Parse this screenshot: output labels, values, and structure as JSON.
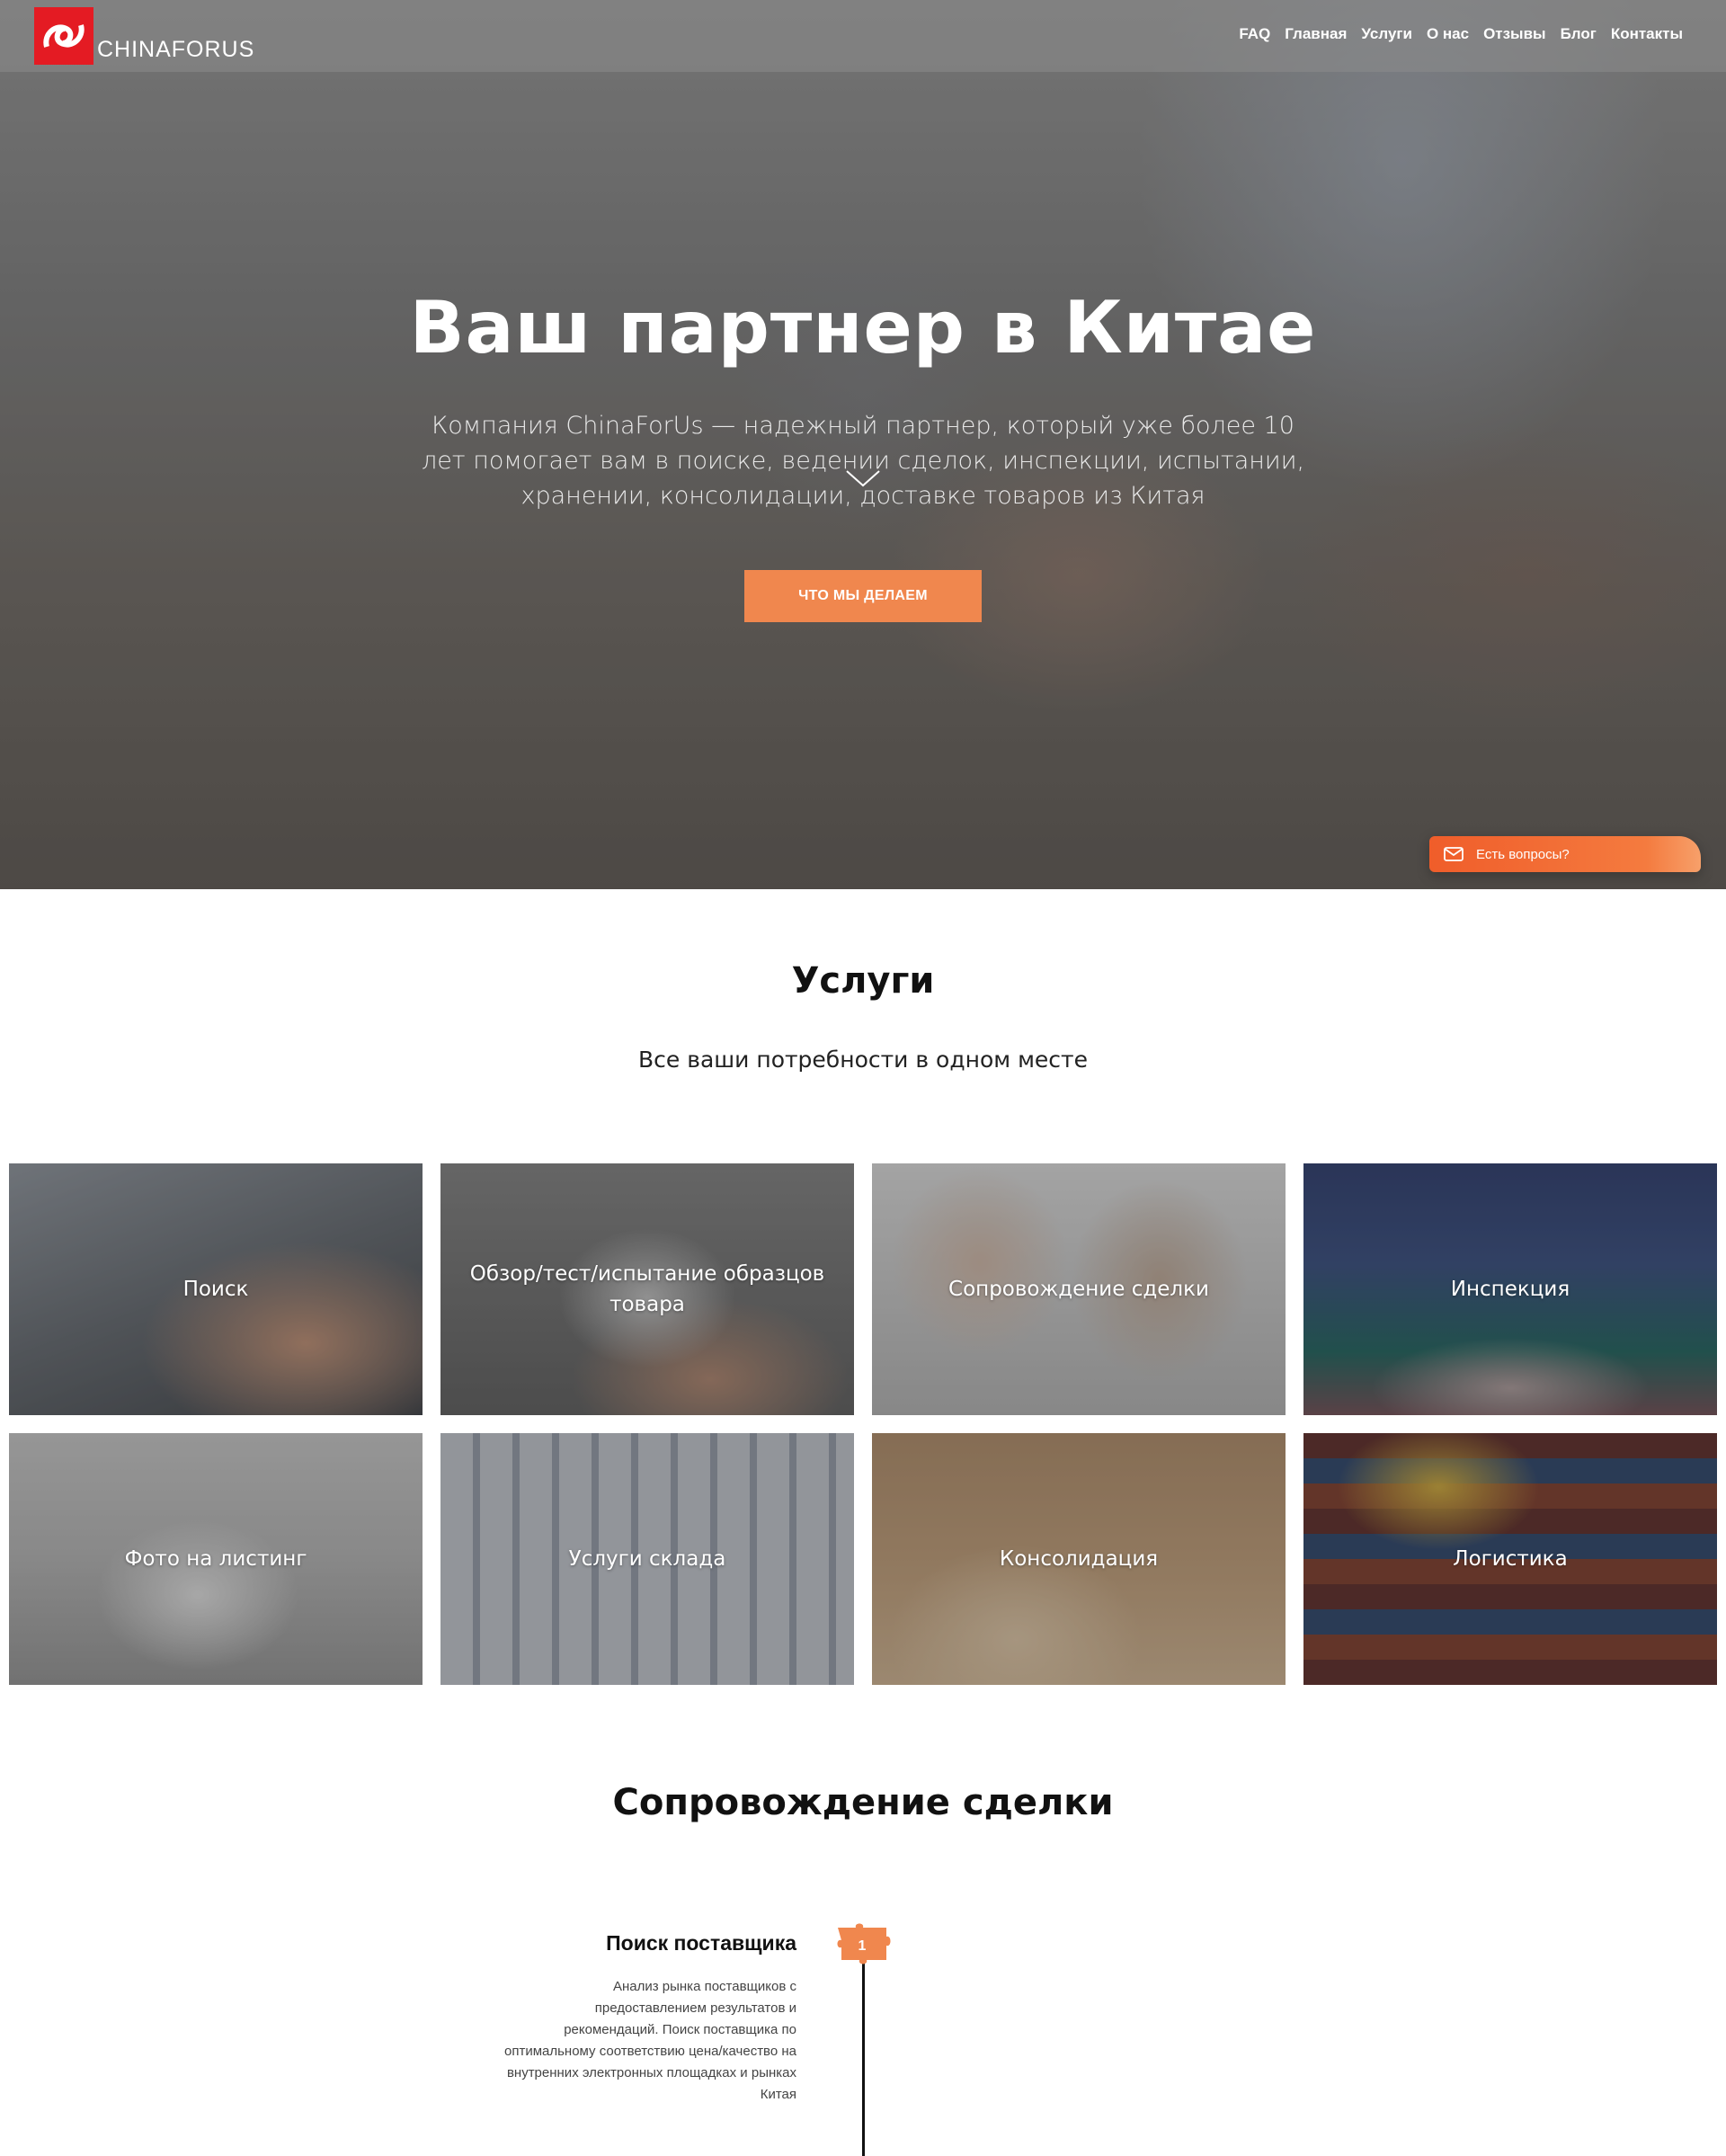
{
  "brand": {
    "name": "CHINAFORUS",
    "accent": "#f0874e",
    "logo_red": "#e41b23"
  },
  "nav": [
    "FAQ",
    "Главная",
    "Услуги",
    "О нас",
    "Отзывы",
    "Блог",
    "Контакты"
  ],
  "hero": {
    "title": "Ваш партнер в Китае",
    "subtitle": "Компания ChinaForUs — надежный партнер, который уже более 10 лет помогает вам в поиске, ведении сделок, инспекции, испытании, хранении, консолидации, доставке товаров из Китая",
    "cta": "ЧТО МЫ ДЕЛАЕМ"
  },
  "question_widget": {
    "label": "Есть вопросы?",
    "icon": "mail-icon"
  },
  "services": {
    "title": "Услуги",
    "subtitle": "Все ваши потребности в одном месте",
    "items": [
      "Поиск",
      "Обзор/тест/испытание образцов товара",
      "Сопровождение сделки",
      "Инспекция",
      "Фото на листинг",
      "Услуги склада",
      "Консолидация",
      "Логистика"
    ]
  },
  "support": {
    "title": "Сопровождение сделки",
    "steps": [
      {
        "number": "1",
        "title": "Поиск поставщика",
        "desc": "Анализ рынка поставщиков с предоставлением результатов и рекомендаций. Поиск поставщика по оптимальному соответствию цена/качество на внутренних электронных площадках и рынках Китая"
      }
    ]
  }
}
